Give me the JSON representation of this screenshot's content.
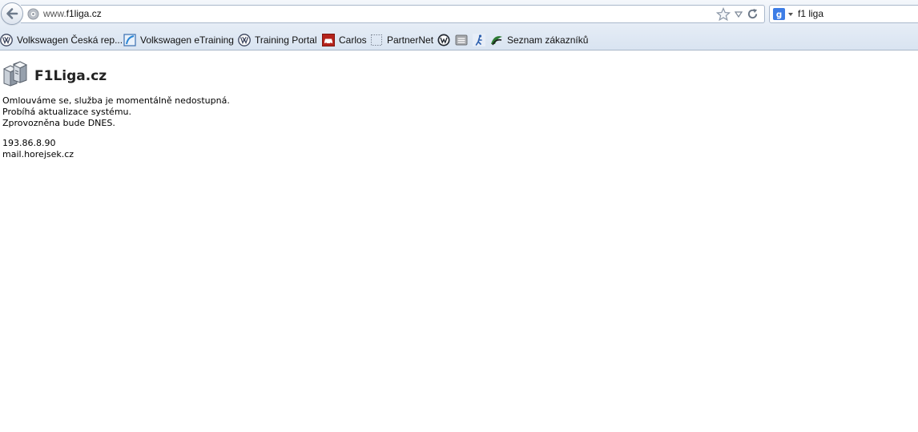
{
  "browser": {
    "url_prefix": "www.",
    "url_host": "f1liga.cz",
    "search_query": "f1 liga",
    "search_engine_icon": "google-icon"
  },
  "bookmarks": [
    {
      "label": "Volkswagen Česká rep...",
      "icon": "vw-icon"
    },
    {
      "label": "Volkswagen eTraining",
      "icon": "etraining-icon"
    },
    {
      "label": "Training Portal",
      "icon": "vw-icon"
    },
    {
      "label": "Carlos",
      "icon": "car-icon"
    },
    {
      "label": "PartnerNet",
      "icon": "dotted-square-icon"
    },
    {
      "label": "",
      "icon": "vw-dark-icon"
    },
    {
      "label": "",
      "icon": "seat-icon"
    },
    {
      "label": "",
      "icon": "runner-icon"
    },
    {
      "label": "Seznam zákazníků",
      "icon": "skoda-icon"
    }
  ],
  "page": {
    "site_title": "F1Liga.cz",
    "messages": [
      "Omlouváme se, služba je momentálně nedostupná.",
      "Probíhá aktualizace systému.",
      "Zprovozněna bude DNES."
    ],
    "ip_address": "193.86.8.90",
    "mail_host": "mail.horejsek.cz"
  }
}
